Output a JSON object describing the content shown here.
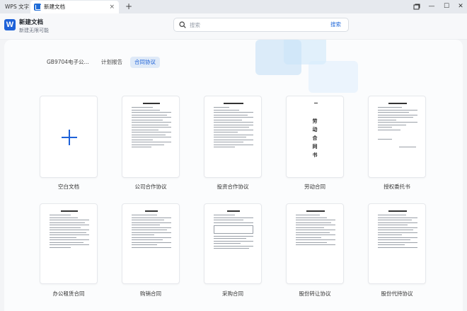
{
  "titlebar": {
    "app_tab": "WPS 文字",
    "doc_tab": "新建文档",
    "close_glyph": "×",
    "add_glyph": "+",
    "min_glyph": "—",
    "max_glyph": "☐",
    "win_close_glyph": "✕"
  },
  "header": {
    "logo": "W",
    "title": "新建文档",
    "subtitle": "新建无限可能",
    "search_placeholder": "搜索",
    "search_button": "搜索"
  },
  "tabs": [
    "GB9704电子公...",
    "计划报告",
    "合同协议"
  ],
  "active_tab": "合同协议",
  "templates_row1": [
    "空白文档",
    "公司合作协议",
    "投资合作协议",
    "劳动合同",
    "授权委托书"
  ],
  "templates_row2": [
    "办公租赁合同",
    "购销合同",
    "采购合同",
    "股份转让协议",
    "股份代持协议"
  ],
  "labor_contract_cover": [
    "劳",
    "动",
    "合",
    "同",
    "书"
  ],
  "colors": {
    "accent": "#1e62d8",
    "active_tab_bg": "#dfeaf8"
  },
  "icons": [
    "search-icon",
    "plus-icon",
    "word-logo-icon",
    "restore-icon",
    "minimize-icon",
    "maximize-icon",
    "close-icon"
  ]
}
